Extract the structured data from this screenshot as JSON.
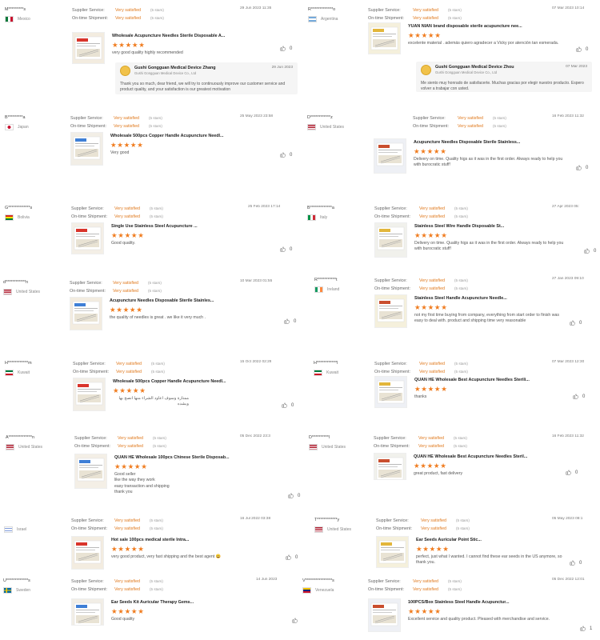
{
  "colors": {
    "accent": "#e07a1f",
    "star": "#f07c1f"
  },
  "labels": {
    "supplier_service": "Supplier Service:",
    "on_time_shipment": "On-time Shipment:"
  },
  "reviews": [
    {
      "buyer": "M*********s",
      "country": "Mexico",
      "flag": "mexico-flag",
      "supplier": "Very satisfied",
      "supplier_stars": "(5 stars)",
      "shipment": "Very satisfied",
      "shipment_stars": "(5 stars)",
      "date": "29 Jun 2023 11:35",
      "product": "Wholesale Acupuncture Needles Sterile Disposable A...",
      "rating": "★★★★★",
      "text": "very good quality highly recommended",
      "likes": "0",
      "reply": {
        "name": "Gushi Gongguan Medical Device Zhang",
        "company": "Gushi Gongguan Medical Device Co., Ltd",
        "date": "29 Jun 2023",
        "text": "Thank you so much, dear friend, we will try to continuously improve our customer service and product quality, and your satisfaction is our greatest motivation"
      }
    },
    {
      "buyer": "R*************o",
      "country": "Argentina",
      "flag": "argentina-flag",
      "supplier": "Very satisfied",
      "supplier_stars": "(5 stars)",
      "shipment": "Very satisfied",
      "shipment_stars": "(5 stars)",
      "date": "07 Mar 2023 10:14",
      "product": "YUAN NIAN brand disposable sterile acupuncture nee...",
      "rating": "★★★★★",
      "text": "excelente material . además quiero agradecer a Vicky por atención tan esmerada.",
      "likes": "0",
      "reply": {
        "name": "Gushi Gongguan Medical Device Zhou",
        "company": "Gushi Gongguan Medical Device Co., Ltd",
        "date": "07 Mar 2023",
        "text": "Me siento muy honrado de satisfacerte. Muchas gracias por elegir nuestro producto. Espero volver a trabajar con usted."
      }
    },
    {
      "buyer": "B*********a",
      "country": "Japan",
      "flag": "japan-flag",
      "supplier": "Very satisfied",
      "supplier_stars": "(5 stars)",
      "shipment": "Very satisfied",
      "shipment_stars": "(5 stars)",
      "date": "25 May 2023 23:58",
      "product": "Wholesale 500pcs Copper Handle Acupuncture Needl...",
      "rating": "★★★★★",
      "text": "Very good",
      "likes": "0"
    },
    {
      "buyer": "D************z",
      "country": "United States",
      "flag": "us-flag",
      "supplier": "Very satisfied",
      "supplier_stars": "(5 stars)",
      "shipment": "Very satisfied",
      "shipment_stars": "(5 stars)",
      "date": "16 Feb 2023 11:32",
      "product": "Acupuncture Needles Disposable Sterile Stainless...",
      "rating": "★★★★★",
      "text": "Delivery on time. Quality higs as it was in the first order. Always ready to help you with burocratic stuff!",
      "likes": "0"
    },
    {
      "buyer": "G*************s",
      "country": "Bolivia",
      "flag": "bolivia-flag",
      "supplier": "Very satisfied",
      "supplier_stars": "(5 stars)",
      "shipment": "Very satisfied",
      "shipment_stars": "(5 stars)",
      "date": "25 Feb 2023 17:14",
      "product": "Single Use Stainless Steel Acupuncture ...",
      "rating": "★★★★★",
      "text": "Good quality.",
      "likes": "0"
    },
    {
      "buyer": "B*************a",
      "country": "Italy",
      "flag": "italy-flag",
      "supplier": "Very satisfied",
      "supplier_stars": "(5 stars)",
      "shipment": "Very satisfied",
      "shipment_stars": "(5 stars)",
      "date": "27 Apr 2023 05:",
      "product": "Stainless Steel Wire Handle Disposable St...",
      "rating": "★★★★★",
      "text": "Delivery on time. Quality higs as it was in the first order. Always ready to help you with burocratic stuff!",
      "likes": "0"
    },
    {
      "buyer": "d************n",
      "country": "United States",
      "flag": "us-flag",
      "supplier": "Very satisfied",
      "supplier_stars": "(5 stars)",
      "shipment": "Very satisfied",
      "shipment_stars": "(5 stars)",
      "date": "10 Mar 2023 01:55",
      "product": "Acupuncture Needles Disposable Sterile Stainles...",
      "rating": "★★★★★",
      "text": "the quality of needles is great . we like it very much .",
      "likes": "0"
    },
    {
      "buyer": "R***********t",
      "country": "Ireland",
      "flag": "ireland-flag",
      "supplier": "Very satisfied",
      "supplier_stars": "(5 stars)",
      "shipment": "Very satisfied",
      "shipment_stars": "(5 stars)",
      "date": "27 Jan 2023 09:10",
      "product": "Stainless Steel Handle Acupuncture Needle...",
      "rating": "★★★★★",
      "text": "not my first time buying from company, everything from start order to finish was easy to deal with. product and shipping time very reasonable",
      "likes": "0"
    },
    {
      "buyer": "H************m",
      "country": "Kuwait",
      "flag": "kuwait-flag",
      "supplier": "Very satisfied",
      "supplier_stars": "(5 stars)",
      "shipment": "Very satisfied",
      "shipment_stars": "(5 stars)",
      "date": "15 Oct 2022 02:29",
      "product": "Wholesale 500pcs Copper Handle Acupuncture Needl...",
      "rating": "★★★★★",
      "text": "ممتازة وسوف اعاود الشراء منها انصح بها وبشده",
      "likes": "0"
    },
    {
      "buyer": "H************l",
      "country": "Kuwait",
      "flag": "kuwait-flag",
      "supplier": "Very satisfied",
      "supplier_stars": "(5 stars)",
      "shipment": "Very satisfied",
      "shipment_stars": "(5 stars)",
      "date": "07 Mar 2023 12:30",
      "product": "QUAN HE Wholesale Best Acupuncture Needles Sterili...",
      "rating": "★★★★★",
      "text": "thanks",
      "likes": "0"
    },
    {
      "buyer": "A**************n",
      "country": "United States",
      "flag": "us-flag",
      "supplier": "Very satisfied",
      "supplier_stars": "(5 stars)",
      "shipment": "Very satisfied",
      "shipment_stars": "(5 stars)",
      "date": "05 Dec 2022 23:3",
      "product": "QUAN HE Wholesale 100pcs Chinese Sterile Disposab...",
      "rating": "★★★★★",
      "text": "Good seller\nlike the way they work\neasy transaction and shipping\nthank you",
      "likes": "0"
    },
    {
      "buyer": "D**********l",
      "country": "United States",
      "flag": "us-flag",
      "supplier": "Very satisfied",
      "supplier_stars": "(5 stars)",
      "shipment": "Very satisfied",
      "shipment_stars": "(5 stars)",
      "date": "16 Feb 2023 11:32",
      "product": "QUAN HE Wholesale Best Acupuncture Needles Steril...",
      "rating": "★★★★★",
      "text": "great product, fast delivery",
      "likes": "0"
    },
    {
      "buyer": "",
      "country": "Israel",
      "flag": "israel-flag",
      "supplier": "Very satisfied",
      "supplier_stars": "(5 stars)",
      "shipment": "Very satisfied",
      "shipment_stars": "(5 stars)",
      "date": "16 Jul 2022 03:38",
      "product": "Hot sale 100pcs medical sterile Intra...",
      "rating": "★★★★★",
      "text": "very good product, very fast shipping and the best agent 😀",
      "likes": "0"
    },
    {
      "buyer": "T************y",
      "country": "United States",
      "flag": "us-flag",
      "supplier": "Very satisfied",
      "supplier_stars": "(5 stars)",
      "shipment": "Very satisfied",
      "shipment_stars": "(5 stars)",
      "date": "05 May 2023 08:1",
      "product": "Ear Seeds Auricular Point Stic...",
      "rating": "★★★★★",
      "text": "perfect, just what I wanted. I cannot find these ear seeds in the US anymore, so thank you.",
      "likes": "0"
    },
    {
      "buyer": "U*************s",
      "country": "Sweden",
      "flag": "sweden-flag",
      "supplier": "Very satisfied",
      "supplier_stars": "(5 stars)",
      "shipment": "Very satisfied",
      "shipment_stars": "(5 stars)",
      "date": "14 Jun 2023",
      "product": "Ear Seeds Kit Auricular Therapy Gems...",
      "rating": "★★★★★",
      "text": "Good quality",
      "likes": ""
    },
    {
      "buyer": "V****************s",
      "country": "Venezuela",
      "flag": "venezuela-flag",
      "supplier": "Very satisfied",
      "supplier_stars": "(5 stars)",
      "shipment": "Very satisfied",
      "shipment_stars": "(5 stars)",
      "date": "05 Dec 2022 12:01",
      "product": "100PCS/Box Stainless Steel Handle Acupunctur...",
      "rating": "★★★★★",
      "text": "Excellent service and quality product. Pleased with merchandise and service.",
      "likes": "1"
    }
  ]
}
